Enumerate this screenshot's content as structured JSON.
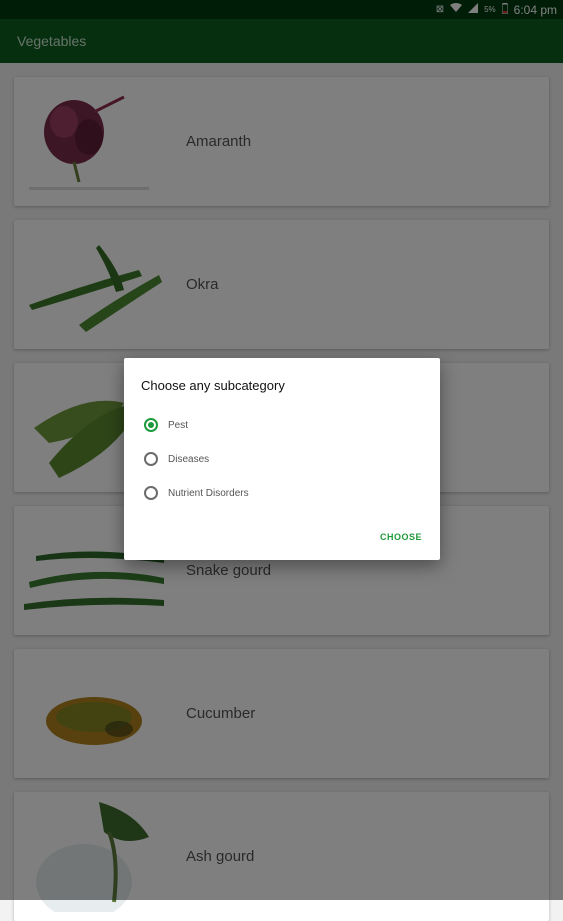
{
  "status_bar": {
    "battery_percent": "5%",
    "time": "6:04 pm"
  },
  "app_bar": {
    "title": "Vegetables"
  },
  "vegetables": [
    {
      "name": "Amaranth"
    },
    {
      "name": "Okra"
    },
    {
      "name": ""
    },
    {
      "name": "Snake gourd"
    },
    {
      "name": "Cucumber"
    },
    {
      "name": "Ash gourd"
    }
  ],
  "dialog": {
    "title": "Choose any subcategory",
    "options": [
      "Pest",
      "Diseases",
      "Nutrient Disorders"
    ],
    "selected": "Pest",
    "choose_label": "CHOOSE"
  },
  "colors": {
    "primary": "#0a5e1e",
    "status_bar": "#003d0e",
    "accent": "#1f9a3a"
  }
}
